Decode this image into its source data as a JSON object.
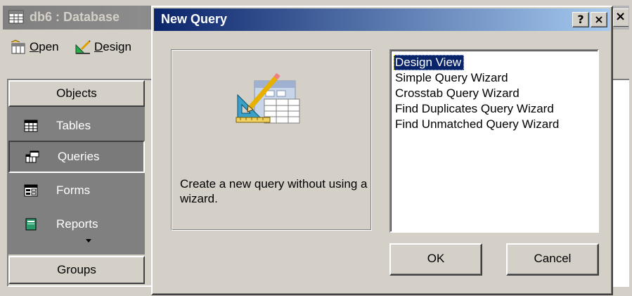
{
  "db_window": {
    "title": "db6 : Database",
    "close_glyph": "×",
    "toolbar": {
      "open_label": "Open",
      "open_mnemonic": "O",
      "design_label": "Design",
      "design_mnemonic": "D"
    },
    "objects_header": "Objects",
    "objects": [
      {
        "label": "Tables",
        "icon": "table-icon"
      },
      {
        "label": "Queries",
        "icon": "query-icon",
        "selected": true
      },
      {
        "label": "Forms",
        "icon": "form-icon"
      },
      {
        "label": "Reports",
        "icon": "report-icon"
      }
    ],
    "groups_label": "Groups"
  },
  "dialog": {
    "title": "New Query",
    "help_glyph": "?",
    "close_glyph": "×",
    "description": "Create a new query without using a wizard.",
    "preview_icon": "query-design-icon",
    "options": [
      {
        "label": "Design View",
        "selected": true
      },
      {
        "label": "Simple Query Wizard"
      },
      {
        "label": "Crosstab Query Wizard"
      },
      {
        "label": "Find Duplicates Query Wizard"
      },
      {
        "label": "Find Unmatched Query Wizard"
      }
    ],
    "ok_label": "OK",
    "cancel_label": "Cancel"
  },
  "colors": {
    "dialog_title_start": "#0a246a",
    "dialog_title_end": "#a6caf0",
    "inactive_title_start": "#808080",
    "face": "#d4d0c8",
    "selection": "#0a246a"
  }
}
